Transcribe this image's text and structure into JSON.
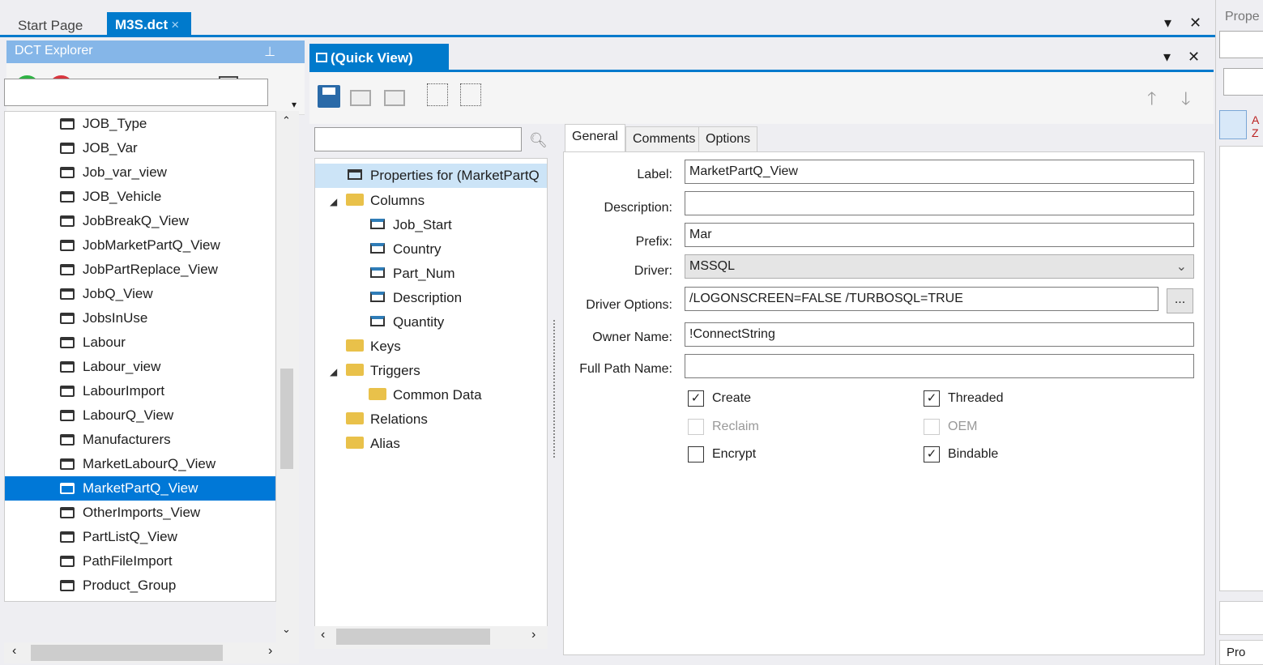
{
  "doc_tabs": {
    "start": "Start Page",
    "active": "M3S.dct",
    "active_close": "×",
    "dropdown": "▾",
    "close": "✕"
  },
  "explorer": {
    "title": "DCT Explorer",
    "pin": "⊥",
    "items": [
      "JOB_Type",
      "JOB_Var",
      "Job_var_view",
      "JOB_Vehicle",
      "JobBreakQ_View",
      "JobMarketPartQ_View",
      "JobPartReplace_View",
      "JobQ_View",
      "JobsInUse",
      "Labour",
      "Labour_view",
      "LabourImport",
      "LabourQ_View",
      "Manufacturers",
      "MarketLabourQ_View",
      "MarketPartQ_View",
      "OtherImports_View",
      "PartListQ_View",
      "PathFileImport",
      "Product_Group"
    ],
    "selected": "MarketPartQ_View",
    "search_value": ""
  },
  "quick_view": {
    "title": "(Quick View)",
    "dropdown": "▾",
    "close": "✕",
    "search_value": "",
    "tree": {
      "root": "Properties for (MarketPartQ",
      "columns": "Columns",
      "column_items": [
        "Job_Start",
        "Country",
        "Part_Num",
        "Description",
        "Quantity"
      ],
      "keys": "Keys",
      "triggers": "Triggers",
      "trigger_items": [
        "Common Data"
      ],
      "relations": "Relations",
      "alias": "Alias"
    }
  },
  "properties": {
    "tabs": [
      "General",
      "Comments",
      "Options"
    ],
    "active_tab": "General",
    "fields": {
      "label": {
        "label": "Label:",
        "value": "MarketPartQ_View"
      },
      "description": {
        "label": "Description:",
        "value": ""
      },
      "prefix": {
        "label": "Prefix:",
        "value": "Mar"
      },
      "driver": {
        "label": "Driver:",
        "value": "MSSQL"
      },
      "driver_options": {
        "label": "Driver Options:",
        "value": "/LOGONSCREEN=FALSE /TURBOSQL=TRUE"
      },
      "owner_name": {
        "label": "Owner Name:",
        "value": "!ConnectString"
      },
      "full_path_name": {
        "label": "Full Path Name:",
        "value": ""
      }
    },
    "browse_button": "...",
    "checkboxes": {
      "create": {
        "label": "Create",
        "checked": true
      },
      "threaded": {
        "label": "Threaded",
        "checked": true
      },
      "reclaim": {
        "label": "Reclaim",
        "checked": false,
        "disabled": true
      },
      "oem": {
        "label": "OEM",
        "checked": false,
        "disabled": true
      },
      "encrypt": {
        "label": "Encrypt",
        "checked": false
      },
      "bindable": {
        "label": "Bindable",
        "checked": true
      }
    }
  },
  "right_panel": {
    "title": "Prope",
    "bottom_tab": "Pro"
  },
  "colors": {
    "accent": "#007acc",
    "selection": "#0078d7",
    "explorer_title": "#85b6e8"
  }
}
